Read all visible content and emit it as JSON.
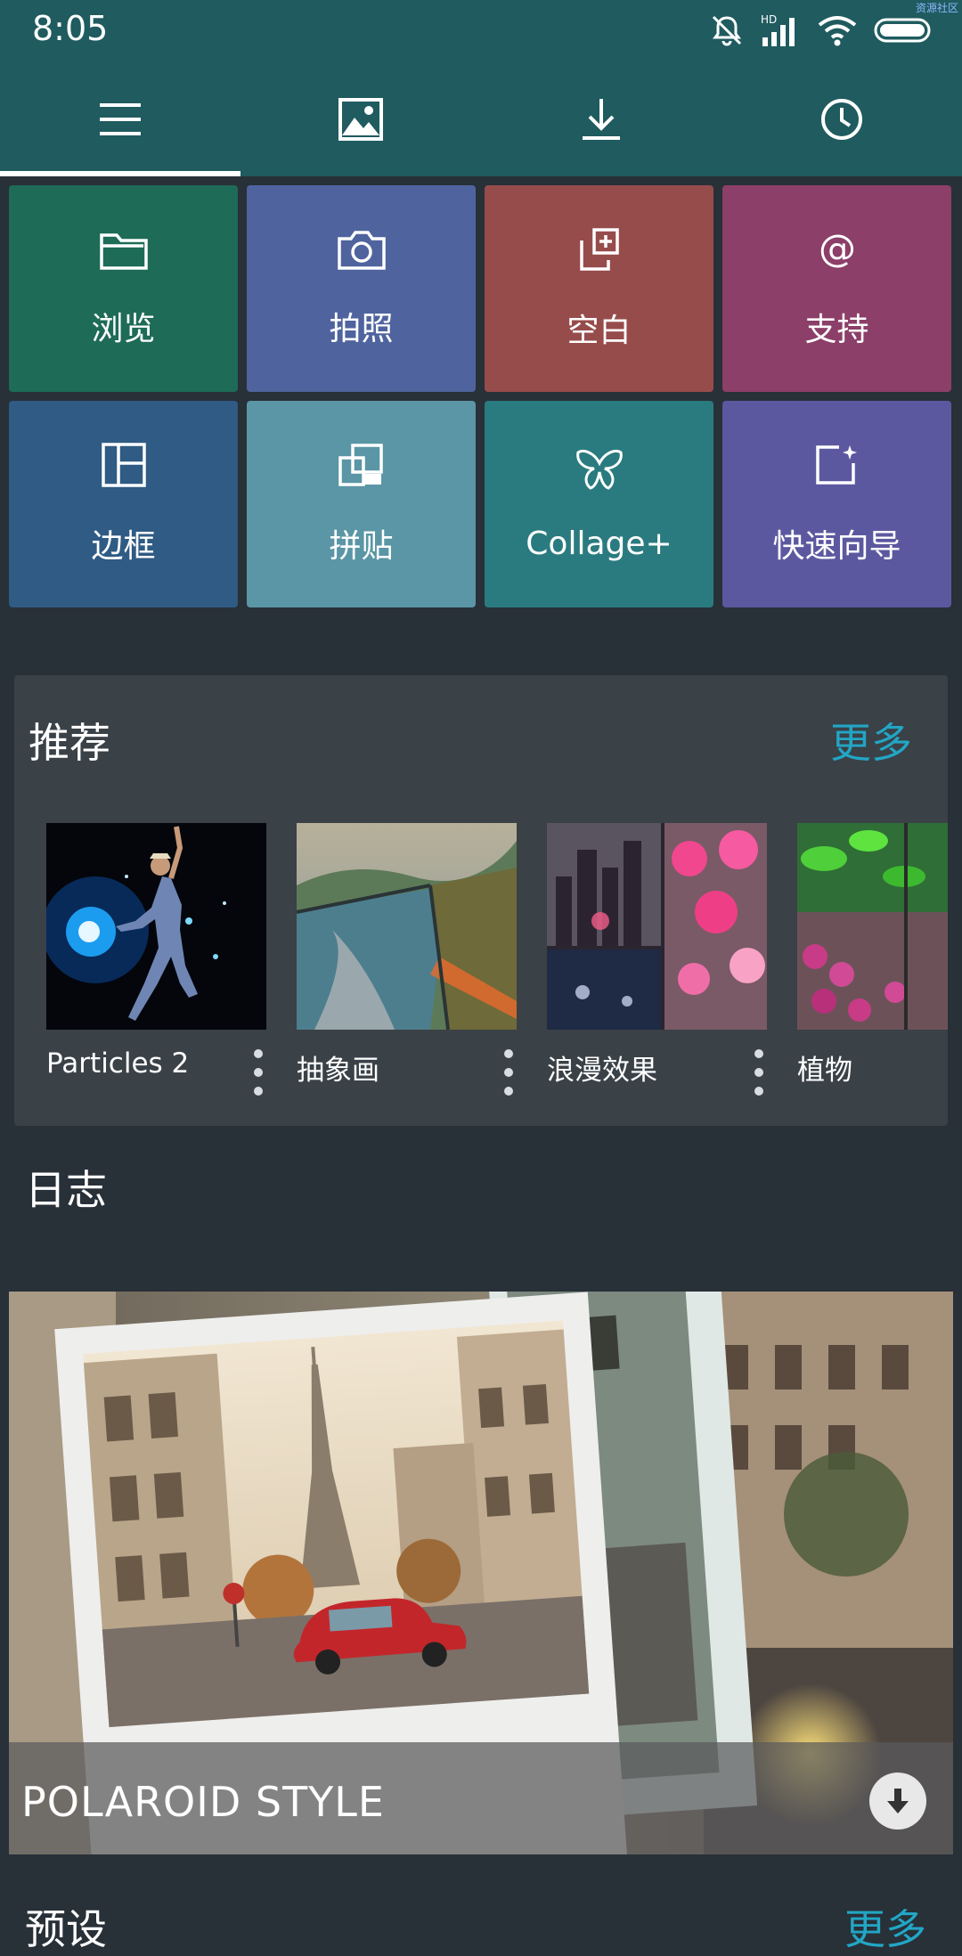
{
  "status": {
    "time": "8:05",
    "corner_text": "资源社区",
    "hd_label": "HD"
  },
  "nav": {
    "tabs": [
      {
        "icon": "menu-icon",
        "active": true
      },
      {
        "icon": "image-icon",
        "active": false
      },
      {
        "icon": "download-icon",
        "active": false
      },
      {
        "icon": "clock-icon",
        "active": false
      }
    ]
  },
  "tiles": [
    {
      "label": "浏览",
      "icon": "folder-icon",
      "color": "#1e6b57"
    },
    {
      "label": "拍照",
      "icon": "camera-icon",
      "color": "#4f649e"
    },
    {
      "label": "空白",
      "icon": "blank-add-icon",
      "color": "#974c4c"
    },
    {
      "label": "支持",
      "icon": "at-icon",
      "color": "#8c3f68"
    },
    {
      "label": "边框",
      "icon": "frame-icon",
      "color": "#2f5b84"
    },
    {
      "label": "拼贴",
      "icon": "collage-icon",
      "color": "#5a96a5"
    },
    {
      "label": "Collage+",
      "icon": "butterfly-icon",
      "color": "#2a7b7f"
    },
    {
      "label": "快速向导",
      "icon": "quick-wizard-icon",
      "color": "#5c58a0"
    }
  ],
  "recommend": {
    "title": "推荐",
    "more": "更多",
    "items": [
      {
        "name": "Particles 2"
      },
      {
        "name": "抽象画"
      },
      {
        "name": "浪漫效果"
      },
      {
        "name": "植物"
      }
    ]
  },
  "journal": {
    "title": "日志",
    "caption": "POLAROID STYLE"
  },
  "presets": {
    "title": "预设",
    "more": "更多"
  },
  "colors": {
    "appbar": "#1f5b5f",
    "background": "#283038",
    "card": "#3a4147",
    "accent": "#22a6c5"
  }
}
